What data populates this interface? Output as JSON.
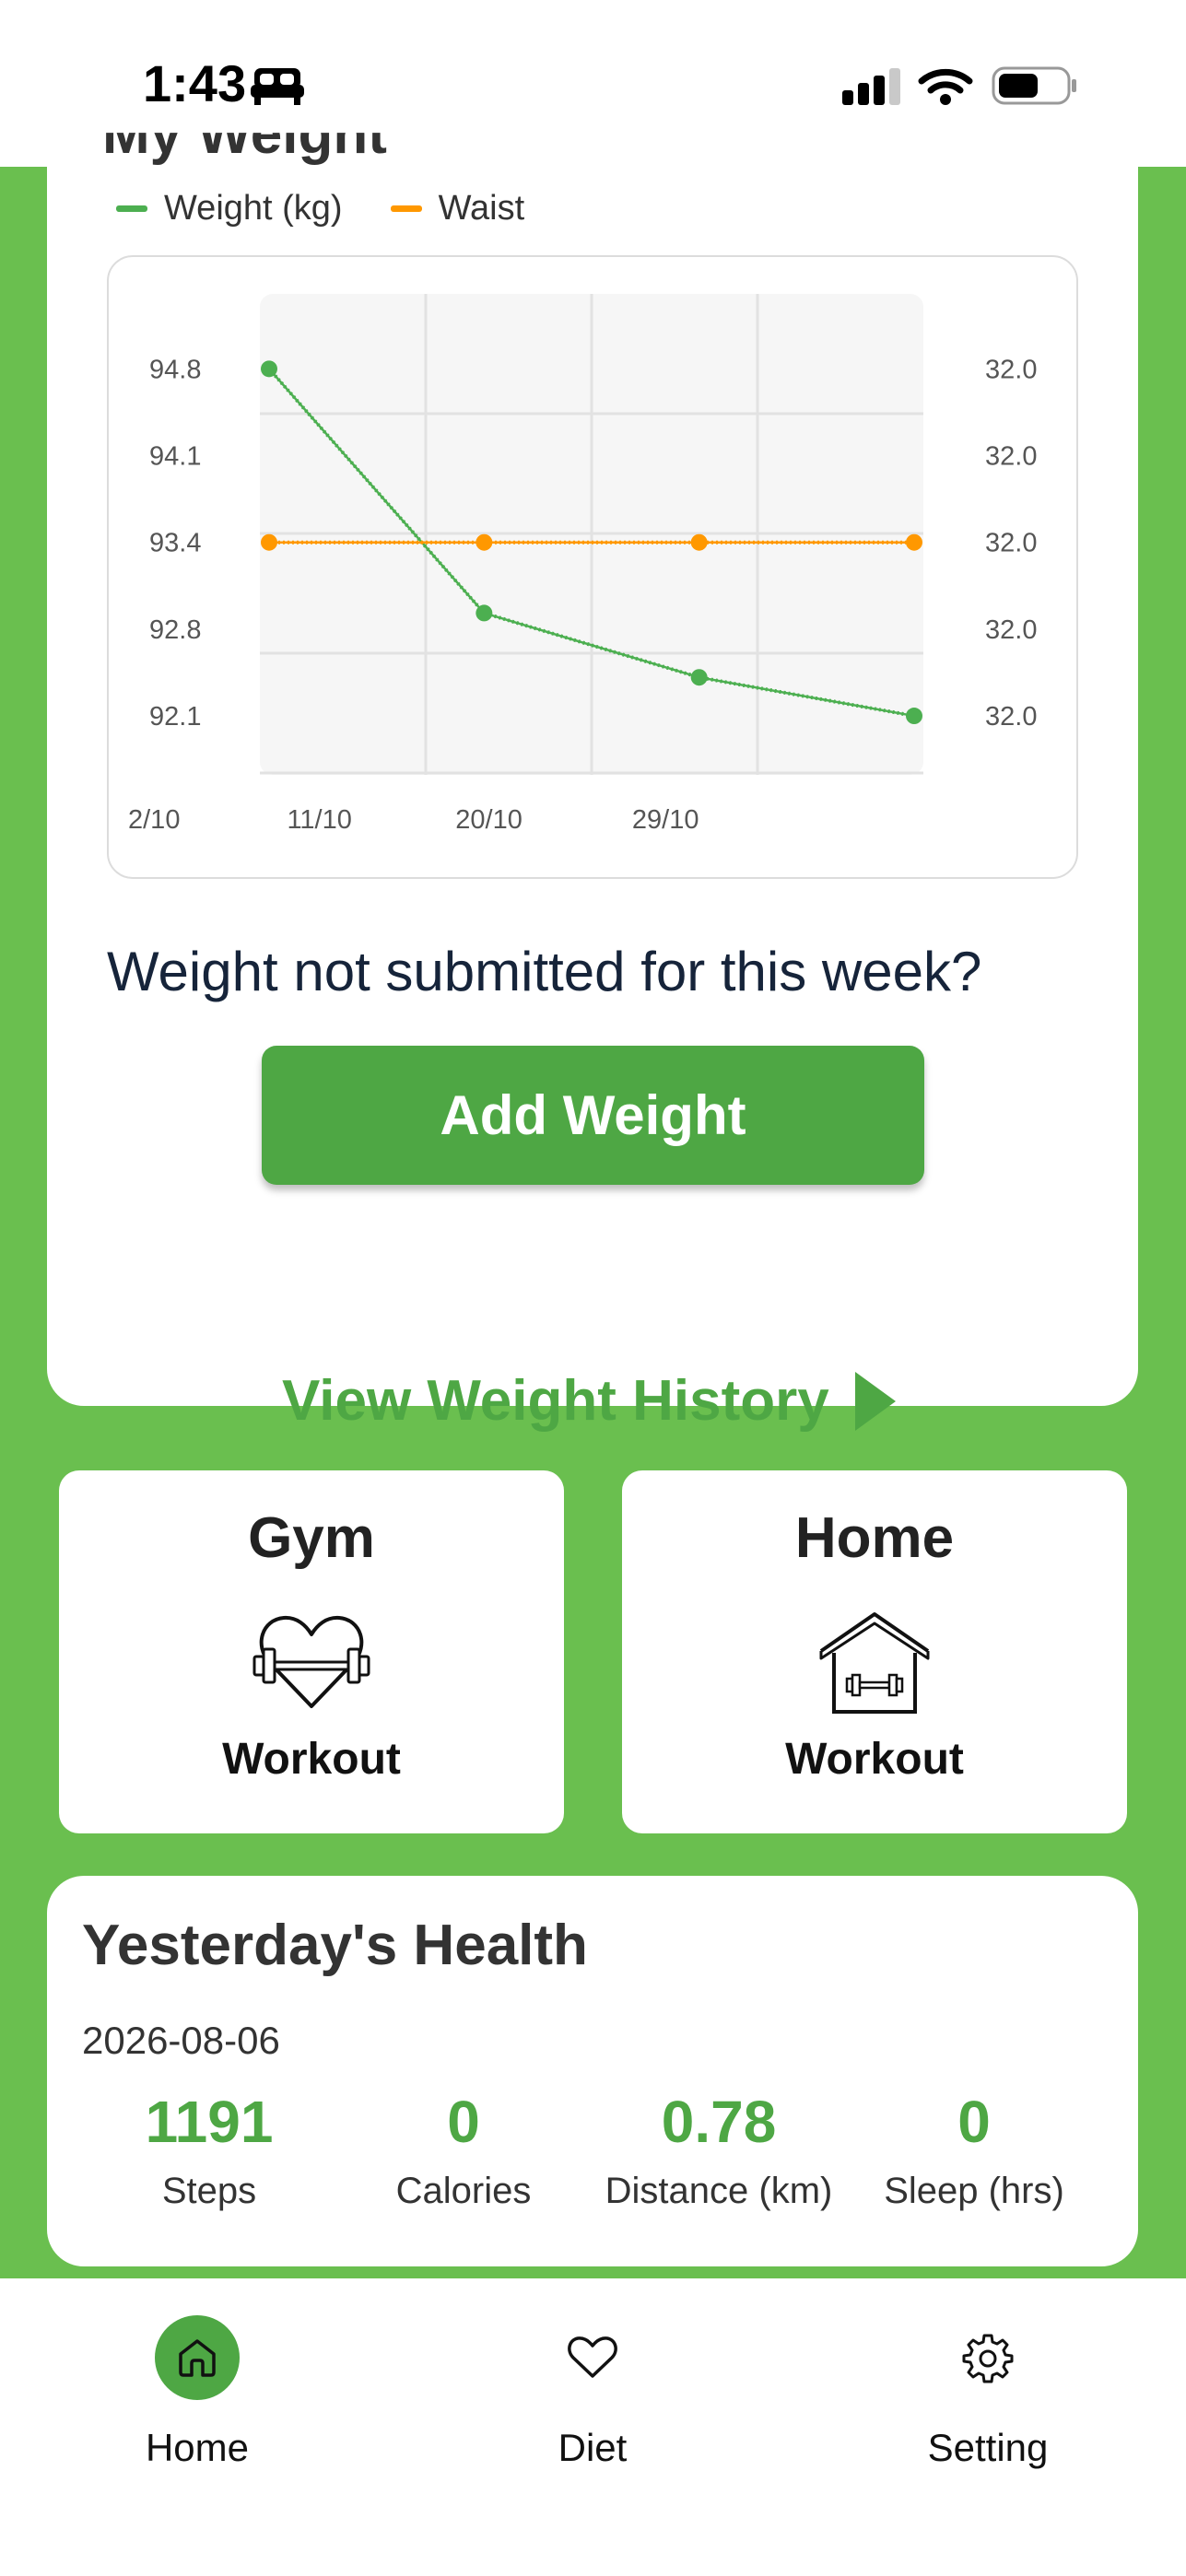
{
  "status_bar": {
    "time": "1:43",
    "icons": [
      "bed-icon",
      "signal-icon",
      "wifi-icon",
      "battery-icon"
    ]
  },
  "weight_card": {
    "title": "My Weight",
    "legend": [
      {
        "label": "Weight (kg)",
        "color": "#4caf50"
      },
      {
        "label": "Waist",
        "color": "#ff9800"
      }
    ]
  },
  "chart_data": {
    "type": "line",
    "x": [
      "2/10",
      "11/10",
      "20/10",
      "29/10"
    ],
    "x_tick_labels": [
      "2/10",
      "11/10",
      "20/10",
      "29/10"
    ],
    "y_left_ticks": [
      "94.8",
      "94.1",
      "93.4",
      "92.8",
      "92.1"
    ],
    "y_right_ticks": [
      "32.0",
      "32.0",
      "32.0",
      "32.0",
      "32.0"
    ],
    "y_left_range": [
      92.1,
      94.8
    ],
    "y_right_range": [
      31.9,
      32.1
    ],
    "series": [
      {
        "name": "Weight (kg)",
        "color": "#4caf50",
        "axis": "left",
        "points": [
          {
            "x": "3/10",
            "y": 94.8
          },
          {
            "x": "13/10",
            "y": 92.9
          },
          {
            "x": "23/10",
            "y": 92.4
          },
          {
            "x": "2/11",
            "y": 92.1
          }
        ]
      },
      {
        "name": "Waist",
        "color": "#ff9800",
        "axis": "right",
        "points": [
          {
            "x": "3/10",
            "y": 32.0
          },
          {
            "x": "13/10",
            "y": 32.0
          },
          {
            "x": "23/10",
            "y": 32.0
          },
          {
            "x": "2/11",
            "y": 32.0
          }
        ]
      }
    ],
    "grid": true
  },
  "prompt": {
    "text": "Weight not submitted for this week?"
  },
  "add_weight": {
    "label": "Add Weight"
  },
  "history": {
    "label": "View Weight History"
  },
  "gym": {
    "title": "Gym",
    "subtitle": "Workout",
    "icon": "heart-dumbbell-icon"
  },
  "home_workout": {
    "title": "Home",
    "subtitle": "Workout",
    "icon": "house-dumbbell-icon"
  },
  "health": {
    "title": "Yesterday's Health",
    "date": "2026-08-06",
    "metrics": [
      {
        "value": "1191",
        "label": "Steps"
      },
      {
        "value": "0",
        "label": "Calories"
      },
      {
        "value": "0.78",
        "label": "Distance (km)"
      },
      {
        "value": "0",
        "label": "Sleep (hrs)"
      }
    ]
  },
  "nav": {
    "accent": "#4ea744",
    "items": [
      {
        "label": "Home",
        "icon": "home-icon",
        "active": true
      },
      {
        "label": "Diet",
        "icon": "heart-icon",
        "active": false
      },
      {
        "label": "Setting",
        "icon": "gear-icon",
        "active": false
      }
    ]
  }
}
